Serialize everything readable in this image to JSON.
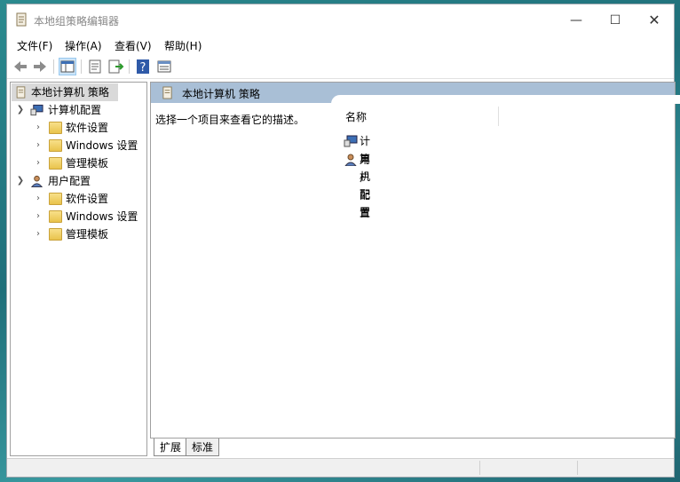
{
  "window": {
    "title": "本地组策略编辑器"
  },
  "menu": [
    "文件(F)",
    "操作(A)",
    "查看(V)",
    "帮助(H)"
  ],
  "tree": {
    "root": "本地计算机 策略",
    "computer": {
      "label": "计算机配置",
      "children": [
        "软件设置",
        "Windows 设置",
        "管理模板"
      ]
    },
    "user": {
      "label": "用户配置",
      "children": [
        "软件设置",
        "Windows 设置",
        "管理模板"
      ]
    }
  },
  "right": {
    "header": "本地计算机 策略",
    "description": "选择一个项目来查看它的描述。",
    "column_name": "名称",
    "items": [
      "计算机配置",
      "用户配置"
    ]
  },
  "tabs": [
    "扩展",
    "标准"
  ],
  "icons": [
    "back-icon",
    "forward-icon",
    "console-tree-icon",
    "properties-icon",
    "export-icon",
    "help-icon",
    "view-icon",
    "policy-icon",
    "folder-icon",
    "computer-icon",
    "user-icon"
  ]
}
